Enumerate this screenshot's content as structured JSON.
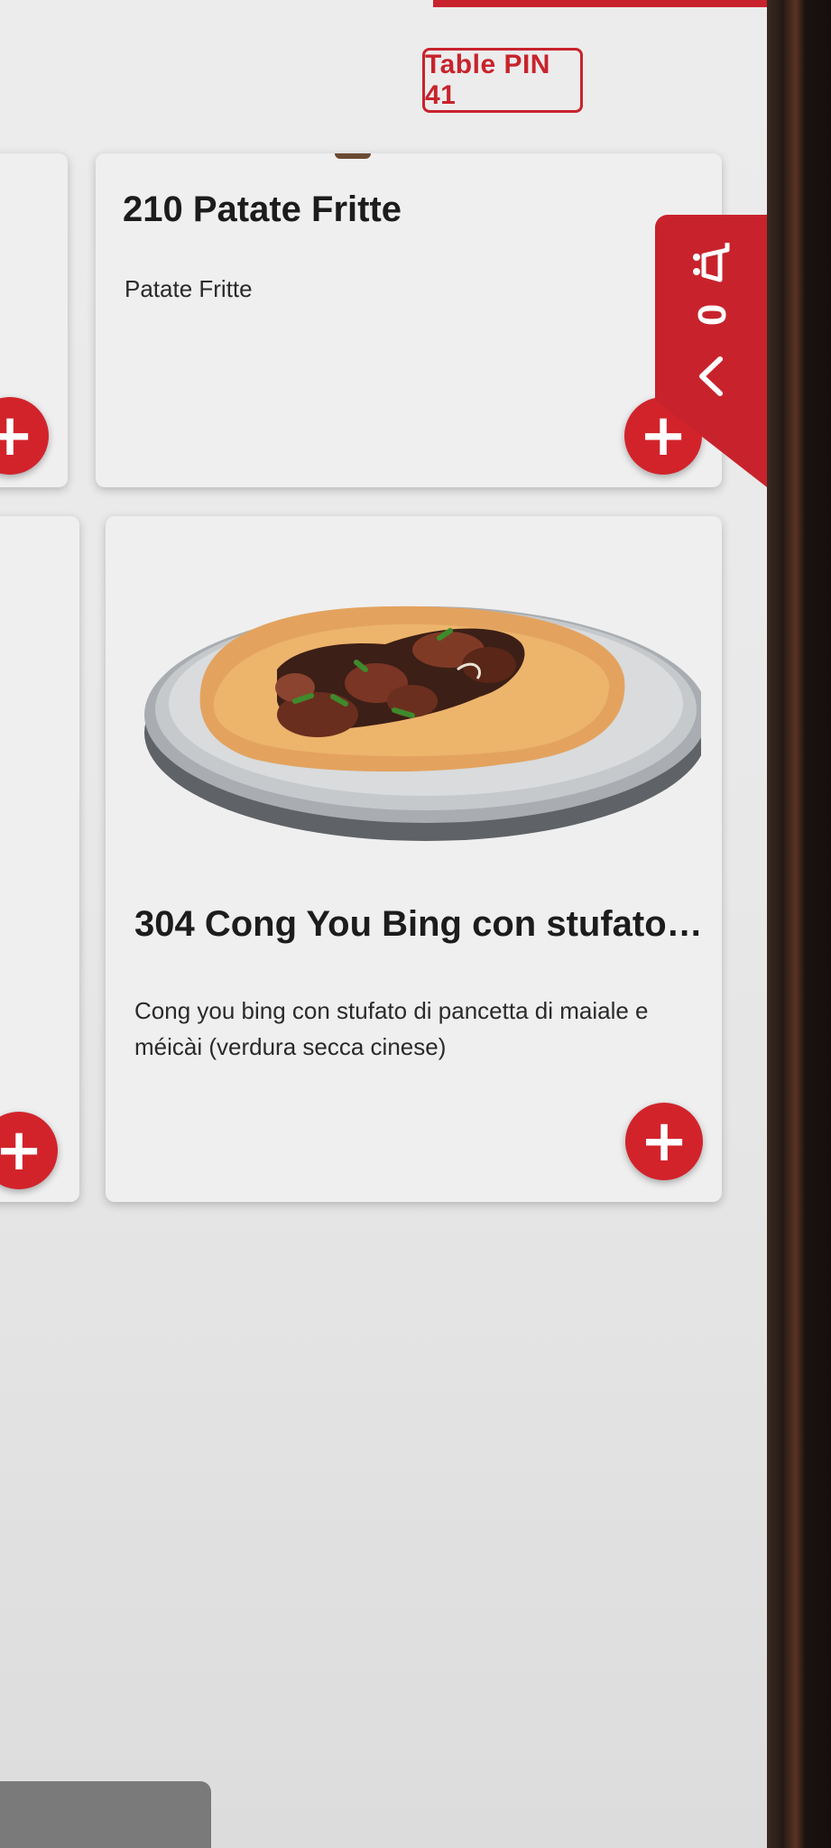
{
  "header": {
    "table_pin_label": "Table PIN 41"
  },
  "cart": {
    "count": "0",
    "icon": "cart-icon",
    "collapse_icon": "chevron-left-icon"
  },
  "menu": {
    "items": [
      {
        "title": "210 Patate Fritte",
        "description": "Patate Fritte",
        "add_icon": "plus-icon"
      },
      {
        "title": "304 Cong You Bing con stufato d...",
        "description": "Cong you bing con stufato di pancetta di maiale e méicài (verdura secca cinese)",
        "add_icon": "plus-icon",
        "image": "dish-photo"
      }
    ]
  },
  "colors": {
    "accent": "#c8232c",
    "card": "#efefef",
    "text": "#1c1c1c"
  }
}
